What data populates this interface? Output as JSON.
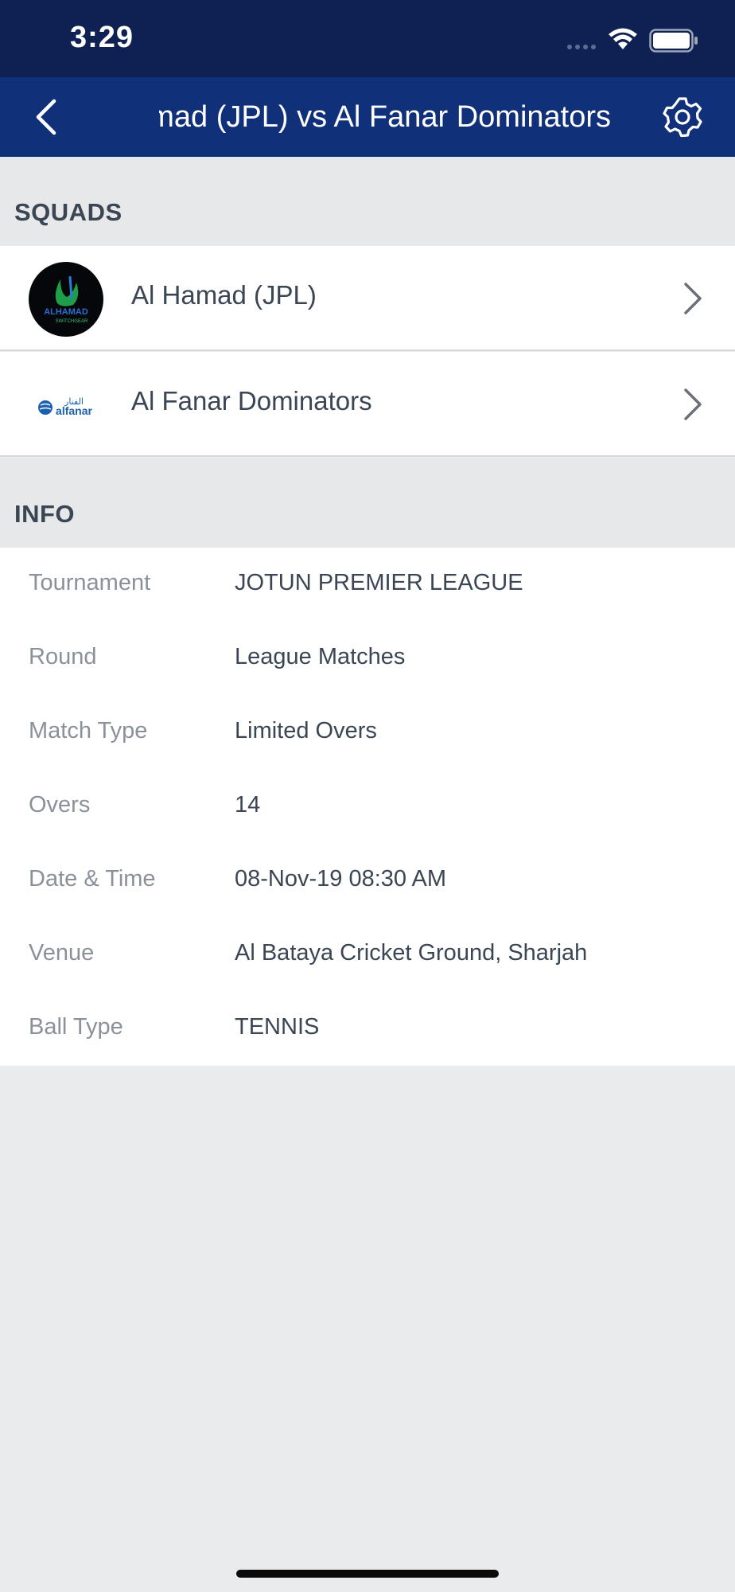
{
  "status_bar": {
    "time": "3:29"
  },
  "nav": {
    "title": "Al Hamad (JPL) vs Al Fanar Dominators"
  },
  "squads": {
    "header": "SQUADS",
    "teams": [
      {
        "name": "Al Hamad (JPL)",
        "logo_text": "ALHAMAD",
        "logo_subtext": "SWITCHGEAR"
      },
      {
        "name": "Al Fanar Dominators",
        "logo_text": "alfanar",
        "logo_arabic": "الفنار"
      }
    ]
  },
  "info": {
    "header": "INFO",
    "rows": [
      {
        "label": "Tournament",
        "value": "JOTUN PREMIER LEAGUE"
      },
      {
        "label": "Round",
        "value": "League Matches"
      },
      {
        "label": "Match Type",
        "value": "Limited Overs"
      },
      {
        "label": "Overs",
        "value": "14"
      },
      {
        "label": "Date & Time",
        "value": "08-Nov-19 08:30 AM"
      },
      {
        "label": "Venue",
        "value": "Al Bataya Cricket Ground, Sharjah"
      },
      {
        "label": "Ball Type",
        "value": "TENNIS"
      }
    ]
  },
  "colors": {
    "status_bar": "#0e2152",
    "nav_bar": "#11307a",
    "background": "#eaebed",
    "alfanar_blue": "#1a5fb0"
  }
}
